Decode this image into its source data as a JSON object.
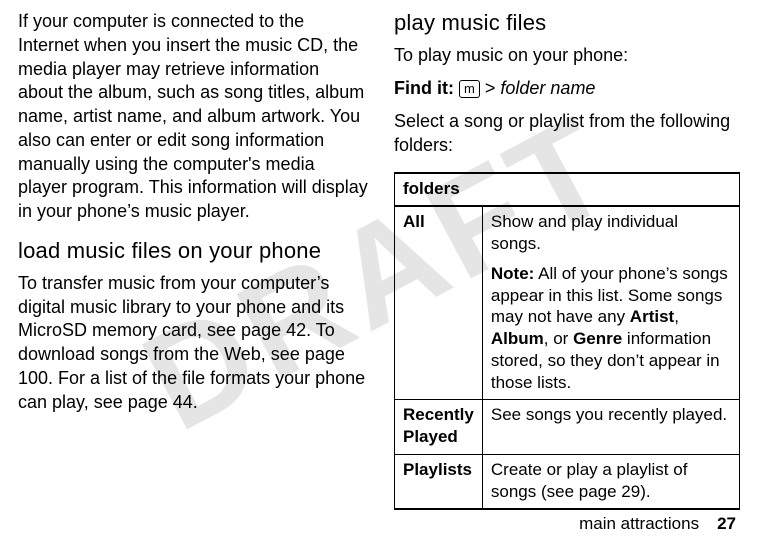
{
  "watermark": "DRAFT",
  "left": {
    "intro": "If your computer is connected to the Internet when you insert the music CD, the media player may retrieve information about the album, such as song titles, album name, artist name, and album artwork. You also can enter or edit song information manually using the computer's media player program. This information will display in your phone’s music player.",
    "heading": "load music files on your phone",
    "para": "To transfer music from your computer’s digital music library to your phone and its MicroSD memory card, see page 42. To download songs from the Web, see page 100. For a list of the file formats your phone can play, see page 44."
  },
  "right": {
    "heading": "play music files",
    "intro": "To play music on your phone:",
    "findit_label": "Find it:",
    "findit_key": "m",
    "findit_gt": ">",
    "findit_path": "folder name",
    "select": "Select a song or playlist from the following folders:",
    "table": {
      "header": "folders",
      "rows": [
        {
          "name": "All",
          "desc": "Show and play individual songs.",
          "note_label": "Note:",
          "note_pre": " All of your phone’s songs appear in this list. Some songs may not have any ",
          "bold1": "Artist",
          "comma": ", ",
          "bold2": "Album",
          "mid": ", or ",
          "bold3": "Genre",
          "note_post": " information stored, so they don’t appear in those lists."
        },
        {
          "name": "Recently Played",
          "desc": "See songs you recently played."
        },
        {
          "name": "Playlists",
          "desc": "Create or play a playlist of songs (see page 29)."
        }
      ]
    }
  },
  "footer": {
    "section": "main attractions",
    "page": "27"
  }
}
